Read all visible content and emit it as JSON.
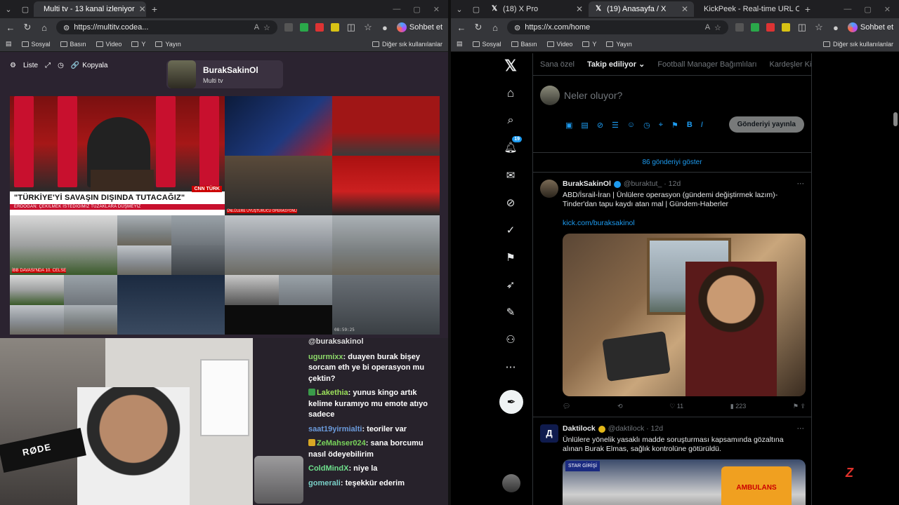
{
  "left": {
    "tabs": [
      {
        "title": "Multi tv - 13 kanal izleniyor",
        "active": true
      }
    ],
    "url": "https://multitv.codea...",
    "copilot": "Sohbet et",
    "bookmarks": [
      "Sosyal",
      "Basın",
      "Video",
      "Y",
      "Yayın"
    ],
    "bookmarks_right": "Diğer sık kullanılanlar",
    "toolbar": {
      "list": "Liste",
      "copy": "Kopyala"
    },
    "channel": {
      "name": "BurakSakinOl",
      "sub": "Multi tv"
    },
    "tiles": {
      "headline": "\"TÜRKİYE'Yİ SAVAŞIN DIŞINDA TUTACAĞIZ\"",
      "sub": "ERDOĞAN: ÇEKİLMEK İSTEDİĞİMİZ TUZAKLARA DÜŞMEYİZ",
      "network": "CNN TÜRK",
      "news2": "ÜNLÜLERE UYUŞTURUCU OPERASYONU",
      "news3": "İBB DAVASI'NDA 10. CELSE",
      "cam_time": "08:59:25"
    },
    "chat": {
      "top": "@buraksakinol",
      "messages": [
        {
          "user": "ugurmixx",
          "color": "#8dd96a",
          "text": "duayen burak bişey sorcam eth ye bi operasyon mu çektin?"
        },
        {
          "user": "Lakethia",
          "color": "#9ce05b",
          "text": "yunus kingo artık kelime kuramıyo mu emote atıyo sadece",
          "badge": "#3a9b4a"
        },
        {
          "user": "saat19yirmialti",
          "color": "#6b9bdc",
          "text": "teoriler var"
        },
        {
          "user": "ZeMahser024",
          "color": "#79d45b",
          "text": "sana borcumu nasıl ödeyebilirim",
          "badge": "#d8a824"
        },
        {
          "user": "ColdMindX",
          "color": "#6ee08c",
          "text": "niye la"
        },
        {
          "user": "gomerali",
          "color": "#7ad0c8",
          "text": "teşekkür ederim"
        }
      ]
    },
    "webcam_mic": "RØDE"
  },
  "right": {
    "tabs": [
      {
        "title": "(18) X Pro",
        "active": false
      },
      {
        "title": "(19) Anasayfa / X",
        "active": true
      },
      {
        "title": "KickPeek - Real-time URL Crawl",
        "active": false
      }
    ],
    "url": "https://x.com/home",
    "copilot": "Sohbet et",
    "bookmarks": [
      "Sosyal",
      "Basın",
      "Video",
      "Y",
      "Yayın"
    ],
    "bookmarks_right": "Diğer sık kullanılanlar",
    "x": {
      "notif_count": "19",
      "feed_tabs": [
        "Sana özel",
        "Takip ediliyor",
        "Football Manager Bağımlıları",
        "Kardeşler Kira"
      ],
      "compose_placeholder": "Neler oluyor?",
      "post_button": "Gönderiyi yayınla",
      "show_more": "86 gönderiyi göster",
      "posts": [
        {
          "name": "BurakSakinOl",
          "handle": "@buraktut_ · 12d",
          "text": "ABD/İsrail-İran | Ünlülere operasyon (gündemi değiştirmek lazım)-Tinder'dan tapu kaydı atan mal | Gündem-Haberler",
          "link": "kick.com/buraksakinol",
          "likes": "11",
          "views": "223"
        },
        {
          "name": "Daktilock",
          "handle": "@daktilock · 12d",
          "text": "Ünlülere yönelik yasaklı madde soruşturması kapsamında gözaltına alınan Burak Elmas, sağlık kontrolüne götürüldü.",
          "image_label": "AMBULANS",
          "image_sign": "STAR GİRİŞİ"
        }
      ]
    }
  }
}
